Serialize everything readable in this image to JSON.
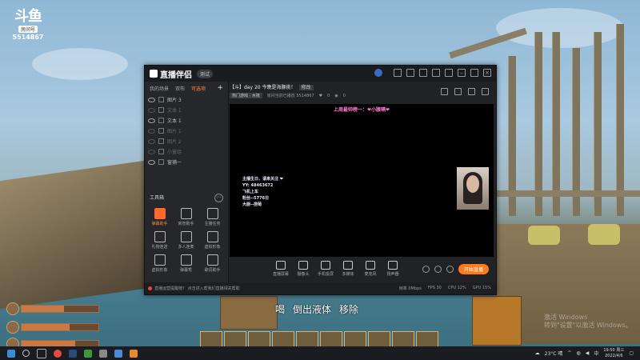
{
  "overlay_logo": {
    "mark": "斗鱼",
    "badge": "房间号",
    "room": "5514867"
  },
  "app": {
    "name": "直播伴侣",
    "version_badge": "测试",
    "tabs": [
      "我的场景",
      "双布",
      "可选项"
    ],
    "scene_items": [
      {
        "label": "图片 3",
        "visible": true
      },
      {
        "label": "文本 1",
        "visible": false
      },
      {
        "label": "文本 1",
        "visible": true
      },
      {
        "label": "图片 1",
        "visible": false
      },
      {
        "label": "图片 2",
        "visible": false
      },
      {
        "label": "小窗组",
        "visible": false
      },
      {
        "label": "窗捕一",
        "visible": true
      }
    ],
    "tools_title": "工具箱",
    "tools": [
      {
        "label": "弹幕助手",
        "hot": true
      },
      {
        "label": "房管助手",
        "hot": false
      },
      {
        "label": "主播任务",
        "hot": false
      },
      {
        "label": "礼物连送",
        "hot": false
      },
      {
        "label": "多人连麦",
        "hot": false
      },
      {
        "label": "虚拟形象",
        "hot": false
      },
      {
        "label": "虚拟形象",
        "hot": false
      },
      {
        "label": "弹幕秀",
        "hot": false
      },
      {
        "label": "歌词助手",
        "hot": false
      }
    ],
    "stream_title": "【斗】day 20 今晚是海豚挑！",
    "edit_label": "修改",
    "category_tag": "热门游戏 · 木筏",
    "stream_meta": "房间当前已播放 5514867",
    "likes": "0",
    "viewers": "0",
    "preview": {
      "top_text": "上周最帅榜一：❤小腰嗝❤",
      "left_lines": [
        "主播生日，请来关注 ❤",
        "YY: 48463672",
        "飞机上车",
        "粉丝--5776日",
        "大厨--捞萄"
      ]
    },
    "controls": [
      "直播屏幕",
      "摄像头",
      "手机投屏",
      "多媒体",
      "麦克风",
      "扬声器"
    ],
    "start_button": "开始直播",
    "notice": "直播运营提醒榜？ 点击进入帮我们直播相关帮助",
    "stats": [
      "帧率 0Mbps",
      "FPS 30",
      "CPU 12%",
      "GPU 15%"
    ]
  },
  "game": {
    "actions": [
      "喝",
      "倒出液体",
      "移除"
    ],
    "hud": [
      {
        "name": "health",
        "fill": 0.55
      },
      {
        "name": "thirst",
        "fill": 0.62
      },
      {
        "name": "hunger",
        "fill": 0.7
      }
    ],
    "watermark": [
      "激活 Windows",
      "转到\"设置\"以激活 Windows。"
    ]
  },
  "taskbar": {
    "weather": "23°C 晴",
    "time": "19:50 周三",
    "date": "2022/4/6"
  }
}
